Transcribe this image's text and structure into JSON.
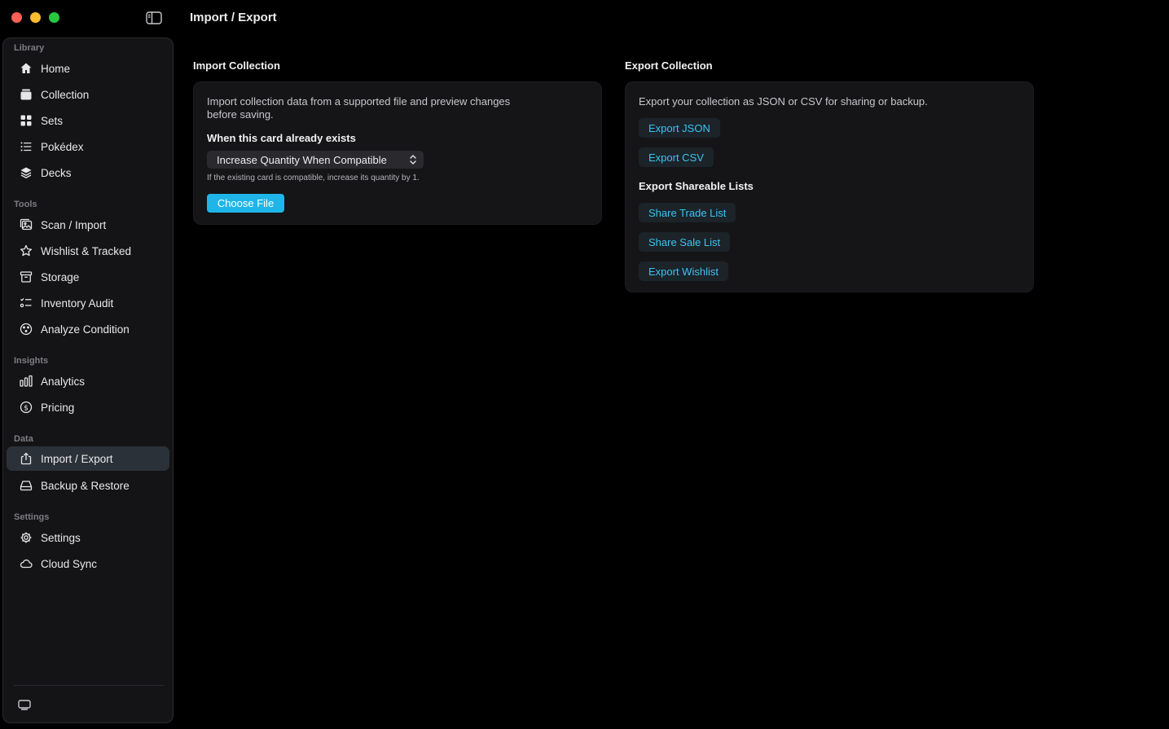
{
  "window": {
    "title": "Import / Export"
  },
  "sidebar": {
    "sections": [
      {
        "label": "Library",
        "items": [
          {
            "label": "Home",
            "icon": "house-icon"
          },
          {
            "label": "Collection",
            "icon": "card-stack-icon"
          },
          {
            "label": "Sets",
            "icon": "grid-icon"
          },
          {
            "label": "Pokédex",
            "icon": "list-icon"
          },
          {
            "label": "Decks",
            "icon": "layers-icon"
          }
        ]
      },
      {
        "label": "Tools",
        "items": [
          {
            "label": "Scan / Import",
            "icon": "photo-scan-icon"
          },
          {
            "label": "Wishlist & Tracked",
            "icon": "star-icon"
          },
          {
            "label": "Storage",
            "icon": "archive-box-icon"
          },
          {
            "label": "Inventory Audit",
            "icon": "checklist-icon"
          },
          {
            "label": "Analyze Condition",
            "icon": "condition-gauge-icon"
          }
        ]
      },
      {
        "label": "Insights",
        "items": [
          {
            "label": "Analytics",
            "icon": "bar-chart-icon"
          },
          {
            "label": "Pricing",
            "icon": "dollar-circle-icon"
          }
        ]
      },
      {
        "label": "Data",
        "items": [
          {
            "label": "Import / Export",
            "icon": "share-export-icon",
            "active": true
          },
          {
            "label": "Backup & Restore",
            "icon": "drive-icon"
          }
        ]
      },
      {
        "label": "Settings",
        "items": [
          {
            "label": "Settings",
            "icon": "gear-icon"
          },
          {
            "label": "Cloud Sync",
            "icon": "cloud-icon"
          }
        ]
      }
    ]
  },
  "import": {
    "title": "Import Collection",
    "description_line1": "Import collection data from a supported file and preview changes",
    "description_line2": "before saving.",
    "existing_label": "When this card already exists",
    "select_value": "Increase Quantity When Compatible",
    "hint": "If the existing card is compatible, increase its quantity by 1.",
    "choose_file": "Choose File"
  },
  "export": {
    "title": "Export Collection",
    "description": "Export your collection as JSON or CSV for sharing or backup.",
    "export_json": "Export JSON",
    "export_csv": "Export CSV",
    "shareable_title": "Export Shareable Lists",
    "share_trade": "Share Trade List",
    "share_sale": "Share Sale List",
    "export_wishlist": "Export Wishlist"
  },
  "colors": {
    "accent": "#1fb5e8",
    "link": "#3cc4f0",
    "active_item_bg": "#2b3138"
  }
}
